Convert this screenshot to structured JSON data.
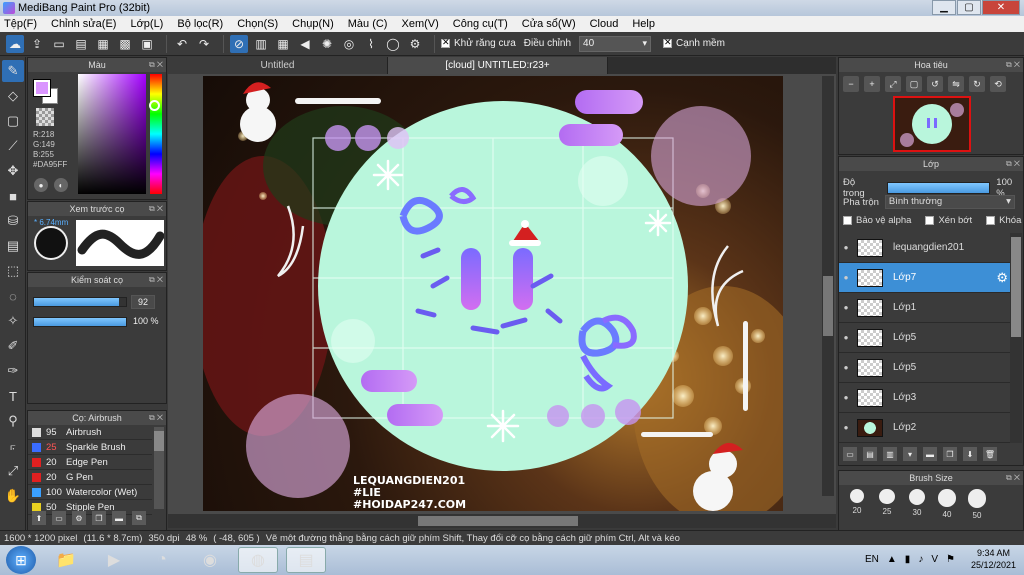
{
  "window": {
    "title": "MediBang Paint Pro (32bit)"
  },
  "menu": [
    "Tệp(F)",
    "Chỉnh sửa(E)",
    "Lớp(L)",
    "Bộ lọc(R)",
    "Chọn(S)",
    "Chụp(N)",
    "Màu (C)",
    "Xem(V)",
    "Công cụ(T)",
    "Cửa sổ(W)",
    "Cloud",
    "Help"
  ],
  "toolbar": {
    "antialias_label": "Khử răng cưa",
    "adjust_label": "Điều chỉnh",
    "adjust_value": "40",
    "snap_label": "Cạnh mềm"
  },
  "color_panel": {
    "title": "Màu",
    "r": "R:218",
    "g": "G:149",
    "b": "B:255",
    "hex": "#DA95FF",
    "fg_color": "#DA95FF"
  },
  "brush_preview": {
    "title": "Xem trước cọ",
    "size": "* 6.74mm"
  },
  "brush_control": {
    "title": "Kiểm soát cọ",
    "size_value": "92",
    "opacity_value": "100 %",
    "size_fraction": 0.92,
    "opacity_fraction": 1.0
  },
  "brush_list": {
    "title": "Cọ: Airbrush",
    "items": [
      {
        "num": "95",
        "name": "Airbrush",
        "color": "#dddddd",
        "red": false
      },
      {
        "num": "25",
        "name": "Sparkle Brush",
        "color": "#3a6cff",
        "red": true
      },
      {
        "num": "20",
        "name": "Edge Pen",
        "color": "#e02020",
        "red": false
      },
      {
        "num": "20",
        "name": "G Pen",
        "color": "#e02020",
        "red": false
      },
      {
        "num": "100",
        "name": "Watercolor (Wet)",
        "color": "#3aa0ff",
        "red": false
      },
      {
        "num": "50",
        "name": "Stipple Pen",
        "color": "#e8d020",
        "red": false
      }
    ]
  },
  "tabs": [
    "Untitled",
    "[cloud] UNTITLED:r23+"
  ],
  "canvas_text": {
    "line1": "LEQUANGDIEN201",
    "line2": "#LIE",
    "line3": "#HOIDAP247.COM"
  },
  "navigator": {
    "title": "Hoa tiêu"
  },
  "layer_panel": {
    "title": "Lớp",
    "opacity_label": "Độ trong",
    "opacity_value": "100 %",
    "blend_label": "Pha trộn",
    "blend_value": "Bình thường",
    "protect_alpha": "Bảo vệ alpha",
    "clipping": "Xén bớt",
    "lock": "Khóa",
    "layers": [
      {
        "name": "lequangdien201",
        "selected": false
      },
      {
        "name": "Lớp7",
        "selected": true
      },
      {
        "name": "Lớp1",
        "selected": false
      },
      {
        "name": "Lớp5",
        "selected": false
      },
      {
        "name": "Lớp5",
        "selected": false
      },
      {
        "name": "Lớp3",
        "selected": false
      },
      {
        "name": "Lớp2",
        "selected": false
      }
    ]
  },
  "brush_size": {
    "title": "Brush Size",
    "sizes": [
      "20",
      "25",
      "30",
      "40",
      "50"
    ]
  },
  "status": {
    "dims": "1600 * 1200 pixel",
    "physical": "(11.6 * 8.7cm)",
    "dpi": "350 dpi",
    "zoom": "48 %",
    "coords": "( -48, 605 )",
    "hint": "Vẽ một đường thẳng bằng cách giữ phím Shift, Thay đổi cỡ cọ bằng cách giữ phím Ctrl, Alt và kéo"
  },
  "taskbar": {
    "lang": "EN",
    "time": "9:34 AM",
    "date": "25/12/2021"
  }
}
